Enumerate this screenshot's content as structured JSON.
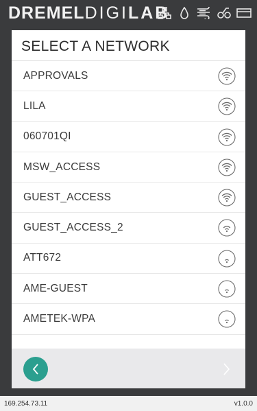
{
  "header": {
    "brand_part1": "DREMEL",
    "brand_part2": "DIGI",
    "brand_part3": "LAB",
    "icons": [
      "network-icon",
      "droplet-icon",
      "fan-icon",
      "filament-icon",
      "printer-icon"
    ]
  },
  "panel": {
    "title": "SELECT A NETWORK",
    "networks": [
      {
        "name": "APPROVALS",
        "signal": "strong"
      },
      {
        "name": "LILA",
        "signal": "strong"
      },
      {
        "name": "060701QI",
        "signal": "strong"
      },
      {
        "name": "MSW_ACCESS",
        "signal": "strong"
      },
      {
        "name": "GUEST_ACCESS",
        "signal": "strong"
      },
      {
        "name": "GUEST_ACCESS_2",
        "signal": "medium"
      },
      {
        "name": "ATT672",
        "signal": "weak"
      },
      {
        "name": "AME-GUEST",
        "signal": "weak"
      },
      {
        "name": "AMETEK-WPA",
        "signal": "weak"
      }
    ]
  },
  "footer": {
    "back_icon": "chevron-left-icon",
    "forward_icon": "chevron-right-icon"
  },
  "status_bar": {
    "ip": "169.254.73.11",
    "version": "v1.0.0"
  },
  "colors": {
    "accent": "#2b9f8f",
    "header_bg": "#3a3b3d",
    "panel_bg": "#ffffff",
    "footer_bg": "#e9e9eb"
  }
}
